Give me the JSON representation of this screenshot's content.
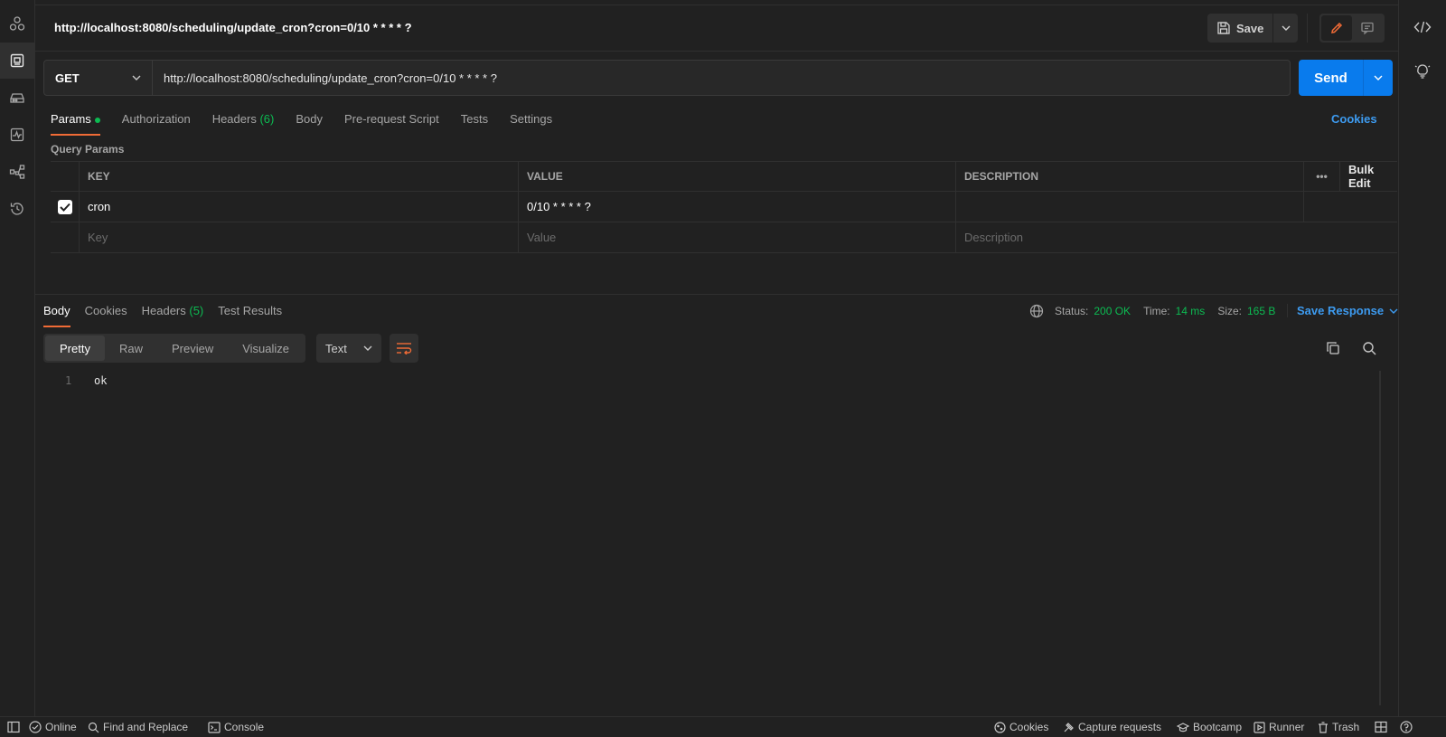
{
  "request": {
    "title": "http://localhost:8080/scheduling/update_cron?cron=0/10 * * * * ?",
    "method": "GET",
    "url": "http://localhost:8080/scheduling/update_cron?cron=0/10 * * * * ?",
    "send_label": "Send",
    "save_label": "Save"
  },
  "tabs": [
    {
      "label": "Params",
      "active": true,
      "has_dot": true
    },
    {
      "label": "Authorization"
    },
    {
      "label": "Headers",
      "count": "(6)"
    },
    {
      "label": "Body"
    },
    {
      "label": "Pre-request Script"
    },
    {
      "label": "Tests"
    },
    {
      "label": "Settings"
    }
  ],
  "cookies_link": "Cookies",
  "query_params": {
    "section_label": "Query Params",
    "headers": {
      "key": "KEY",
      "value": "VALUE",
      "description": "DESCRIPTION",
      "more": "•••",
      "bulk_edit": "Bulk Edit"
    },
    "rows": [
      {
        "checked": true,
        "key": "cron",
        "value": "0/10 * * * * ?",
        "description": ""
      }
    ],
    "placeholders": {
      "key": "Key",
      "value": "Value",
      "description": "Description"
    }
  },
  "response": {
    "tabs": [
      {
        "label": "Body",
        "active": true
      },
      {
        "label": "Cookies"
      },
      {
        "label": "Headers",
        "count": "(5)"
      },
      {
        "label": "Test Results"
      }
    ],
    "status_label": "Status:",
    "status_value": "200 OK",
    "time_label": "Time:",
    "time_value": "14 ms",
    "size_label": "Size:",
    "size_value": "165 B",
    "save_response": "Save Response",
    "formats": [
      "Pretty",
      "Raw",
      "Preview",
      "Visualize"
    ],
    "active_format": "Pretty",
    "language": "Text",
    "body_lines": [
      {
        "no": "1",
        "text": "ok"
      }
    ]
  },
  "footer": {
    "online": "Online",
    "find_replace": "Find and Replace",
    "console": "Console",
    "cookies": "Cookies",
    "capture": "Capture requests",
    "bootcamp": "Bootcamp",
    "runner": "Runner",
    "trash": "Trash"
  },
  "colors": {
    "background": "#212121",
    "accent": "#f06b36",
    "send": "#097bed",
    "success": "#0cbb52",
    "link": "#3d9bf0"
  }
}
